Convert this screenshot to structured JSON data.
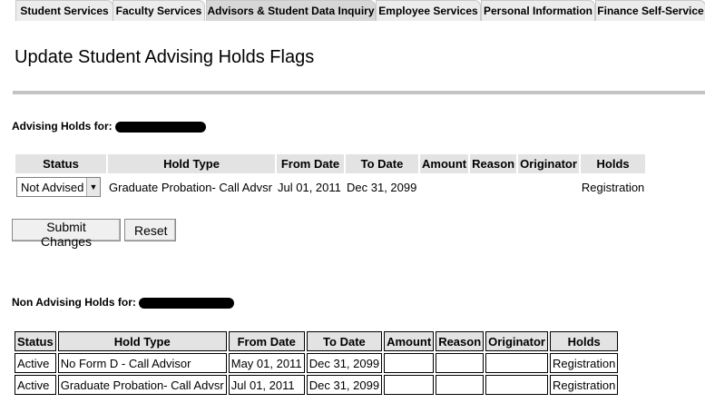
{
  "tabs": [
    {
      "label": "Student Services"
    },
    {
      "label": "Faculty Services"
    },
    {
      "label": "Advisors & Student Data Inquiry",
      "active": true
    },
    {
      "label": "Employee Services"
    },
    {
      "label": "Personal Information"
    },
    {
      "label": "Finance Self-Service"
    }
  ],
  "page": {
    "title": "Update Student Advising Holds Flags"
  },
  "advising": {
    "label": "Advising Holds for:",
    "headers": [
      "Status",
      "Hold Type",
      "From Date",
      "To Date",
      "Amount",
      "Reason",
      "Originator",
      "Holds"
    ],
    "row": {
      "status": "Not Advised",
      "hold_type": "Graduate Probation- Call Advsr",
      "from_date": "Jul 01, 2011",
      "to_date": "Dec 31, 2099",
      "amount": "",
      "reason": "",
      "originator": "",
      "holds": "Registration"
    }
  },
  "buttons": {
    "submit": "Submit Changes",
    "reset": "Reset"
  },
  "non_advising": {
    "label": "Non Advising Holds for:",
    "headers": [
      "Status",
      "Hold Type",
      "From Date",
      "To Date",
      "Amount",
      "Reason",
      "Originator",
      "Holds"
    ],
    "rows": [
      {
        "status": "Active",
        "hold_type": "No Form D - Call Advisor",
        "from_date": "May 01, 2011",
        "to_date": "Dec 31, 2099",
        "amount": "",
        "reason": "",
        "originator": "",
        "holds": "Registration"
      },
      {
        "status": "Active",
        "hold_type": "Graduate Probation- Call Advsr",
        "from_date": "Jul 01, 2011",
        "to_date": "Dec 31, 2099",
        "amount": "",
        "reason": "",
        "originator": "",
        "holds": "Registration"
      }
    ]
  }
}
